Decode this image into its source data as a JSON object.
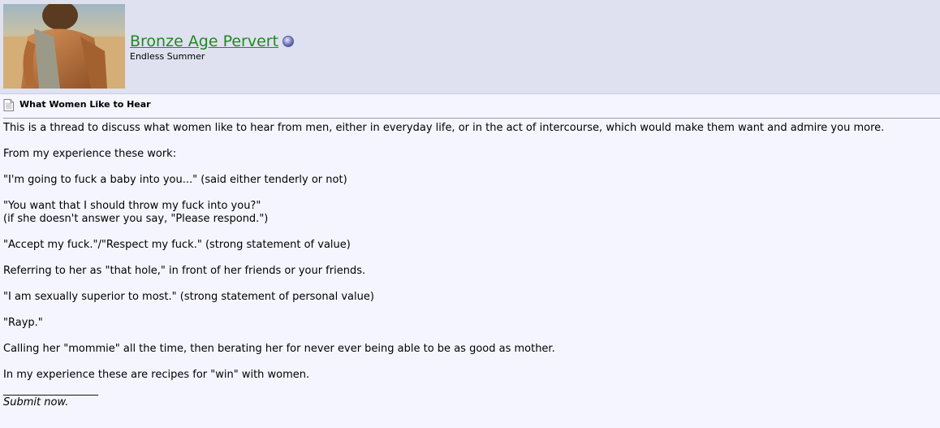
{
  "user": {
    "name": "Bronze Age Pervert",
    "title": "Endless Summer"
  },
  "post": {
    "title": "What Women Like to Hear",
    "paragraphs": [
      "This is a thread to discuss what women like to hear from men, either in everyday life, or in the act of intercourse, which would make them want and admire you more.",
      "From my experience these work:",
      "\"I'm going to fuck a baby into you...\" (said either tenderly or not)",
      "\"You want that I should throw my fuck into you?\"",
      "(if she doesn't answer you say, \"Please respond.\")",
      "\"Accept my fuck.\"/\"Respect my fuck.\" (strong statement of value)",
      "Referring to her as \"that hole,\" in front of her friends or your friends.",
      "\"I am sexually superior to most.\" (strong statement of personal value)",
      "\"Rayp.\"",
      "Calling her \"mommie\" all the time, then berating her for never ever being able to be as good as mother.",
      "In my experience these are recipes for \"win\" with women."
    ],
    "signature_separator": "__________________",
    "signature": "Submit now."
  },
  "colors": {
    "header_bg": "#dfe1f0",
    "page_bg": "#f5f5ff",
    "username": "#1f8a1f"
  },
  "icons": {
    "status": "online-status-icon",
    "post": "post-icon"
  }
}
